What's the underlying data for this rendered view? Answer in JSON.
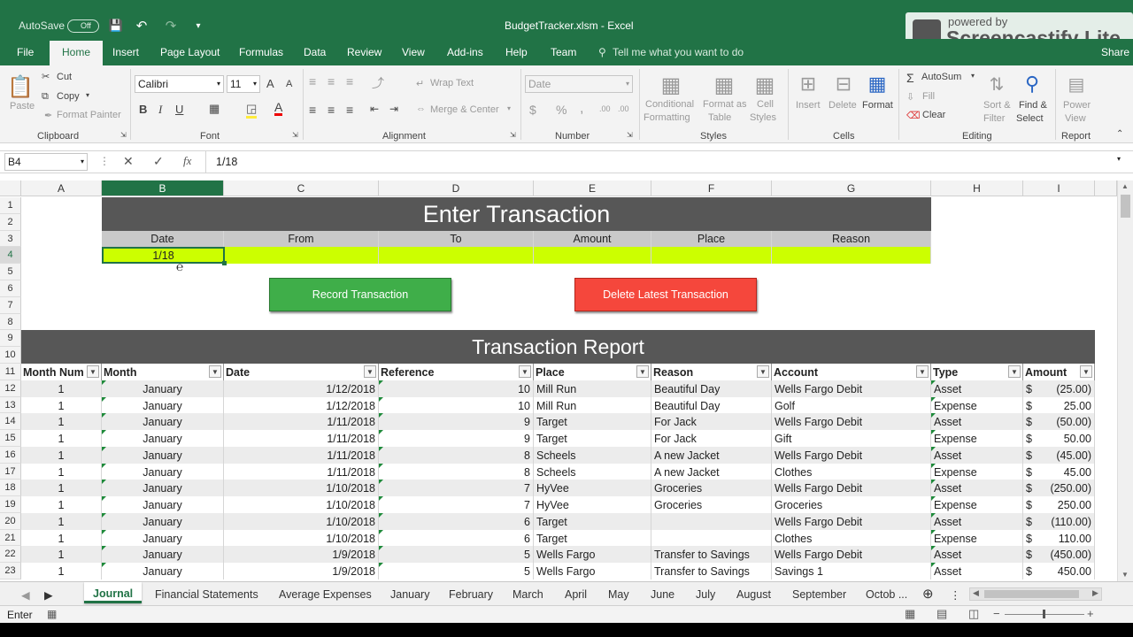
{
  "window": {
    "autosave_label": "AutoSave",
    "autosave_state": "Off",
    "title": "BudgetTracker.xlsm  -  Excel",
    "watermark_top": "powered by",
    "watermark_bottom": "Screencastify Lite"
  },
  "menu": {
    "items": [
      "File",
      "Home",
      "Insert",
      "Page Layout",
      "Formulas",
      "Data",
      "Review",
      "View",
      "Add-ins",
      "Help",
      "Team"
    ],
    "tell_me": "Tell me what you want to do",
    "share": "Share"
  },
  "ribbon": {
    "clipboard": {
      "paste": "Paste",
      "cut": "Cut",
      "copy": "Copy",
      "format_painter": "Format Painter",
      "group": "Clipboard"
    },
    "font": {
      "name": "Calibri",
      "size": "11",
      "bold": "B",
      "italic": "I",
      "underline": "U",
      "grow": "A",
      "shrink": "A",
      "color": "A",
      "group": "Font"
    },
    "alignment": {
      "wrap": "Wrap Text",
      "merge": "Merge & Center",
      "group": "Alignment"
    },
    "number": {
      "format": "Date",
      "currency": "$",
      "percent": "%",
      "comma": ",",
      "group": "Number"
    },
    "styles": {
      "conditional": [
        "Conditional",
        "Formatting"
      ],
      "table": [
        "Format as",
        "Table"
      ],
      "cell": [
        "Cell",
        "Styles"
      ],
      "group": "Styles"
    },
    "cells": {
      "insert": "Insert",
      "delete": "Delete",
      "format": "Format",
      "group": "Cells"
    },
    "editing": {
      "autosum": "AutoSum",
      "fill": "Fill",
      "clear": "Clear",
      "sort": [
        "Sort &",
        "Filter"
      ],
      "find": [
        "Find &",
        "Select"
      ],
      "group": "Editing"
    },
    "report": {
      "power": [
        "Power",
        "View"
      ],
      "group": "Report"
    }
  },
  "formula": {
    "namebox": "B4",
    "content": "1/18",
    "fx": "fx"
  },
  "columns": [
    "A",
    "B",
    "C",
    "D",
    "E",
    "F",
    "G",
    "H",
    "I"
  ],
  "rows": [
    "1",
    "2",
    "3",
    "4",
    "5",
    "6",
    "7",
    "8",
    "9",
    "10",
    "11",
    "12",
    "13",
    "14",
    "15",
    "16",
    "17",
    "18",
    "19",
    "20",
    "21",
    "22",
    "23"
  ],
  "entry": {
    "title": "Enter Transaction",
    "headers": [
      "Date",
      "From",
      "To",
      "Amount",
      "Place",
      "Reason"
    ],
    "date_value": "1/18"
  },
  "buttons": {
    "record": "Record Transaction",
    "delete": "Delete Latest Transaction"
  },
  "report": {
    "title": "Transaction Report",
    "headers": [
      "Month Num",
      "Month",
      "Date",
      "Reference",
      "Place",
      "Reason",
      "Account",
      "Type",
      "Amount"
    ],
    "rows": [
      [
        "1",
        "January",
        "1/12/2018",
        "10",
        "Mill Run",
        "Beautiful Day",
        "Wells Fargo Debit",
        "Asset",
        "$",
        "(25.00)"
      ],
      [
        "1",
        "January",
        "1/12/2018",
        "10",
        "Mill Run",
        "Beautiful Day",
        "Golf",
        "Expense",
        "$",
        "25.00"
      ],
      [
        "1",
        "January",
        "1/11/2018",
        "9",
        "Target",
        "For Jack",
        "Wells Fargo Debit",
        "Asset",
        "$",
        "(50.00)"
      ],
      [
        "1",
        "January",
        "1/11/2018",
        "9",
        "Target",
        "For Jack",
        "Gift",
        "Expense",
        "$",
        "50.00"
      ],
      [
        "1",
        "January",
        "1/11/2018",
        "8",
        "Scheels",
        "A new Jacket",
        "Wells Fargo Debit",
        "Asset",
        "$",
        "(45.00)"
      ],
      [
        "1",
        "January",
        "1/11/2018",
        "8",
        "Scheels",
        "A new Jacket",
        "Clothes",
        "Expense",
        "$",
        "45.00"
      ],
      [
        "1",
        "January",
        "1/10/2018",
        "7",
        "HyVee",
        "Groceries",
        "Wells Fargo Debit",
        "Asset",
        "$",
        "(250.00)"
      ],
      [
        "1",
        "January",
        "1/10/2018",
        "7",
        "HyVee",
        "Groceries",
        "Groceries",
        "Expense",
        "$",
        "250.00"
      ],
      [
        "1",
        "January",
        "1/10/2018",
        "6",
        "Target",
        "",
        "Wells Fargo Debit",
        "Asset",
        "$",
        "(110.00)"
      ],
      [
        "1",
        "January",
        "1/10/2018",
        "6",
        "Target",
        "",
        "Clothes",
        "Expense",
        "$",
        "110.00"
      ],
      [
        "1",
        "January",
        "1/9/2018",
        "5",
        "Wells Fargo",
        "Transfer to Savings",
        "Wells Fargo Debit",
        "Asset",
        "$",
        "(450.00)"
      ],
      [
        "1",
        "January",
        "1/9/2018",
        "5",
        "Wells Fargo",
        "Transfer to Savings",
        "Savings 1",
        "Asset",
        "$",
        "450.00"
      ]
    ]
  },
  "sheets": [
    "Journal",
    "Financial Statements",
    "Average Expenses",
    "January",
    "February",
    "March",
    "April",
    "May",
    "June",
    "July",
    "August",
    "September",
    "Octob ..."
  ],
  "status": {
    "mode": "Enter"
  },
  "colors": {
    "excel_green": "#217346",
    "entry_fill": "#ccff00",
    "header_dark": "#575757",
    "record_btn": "#3fae49",
    "delete_btn": "#f5473c"
  }
}
